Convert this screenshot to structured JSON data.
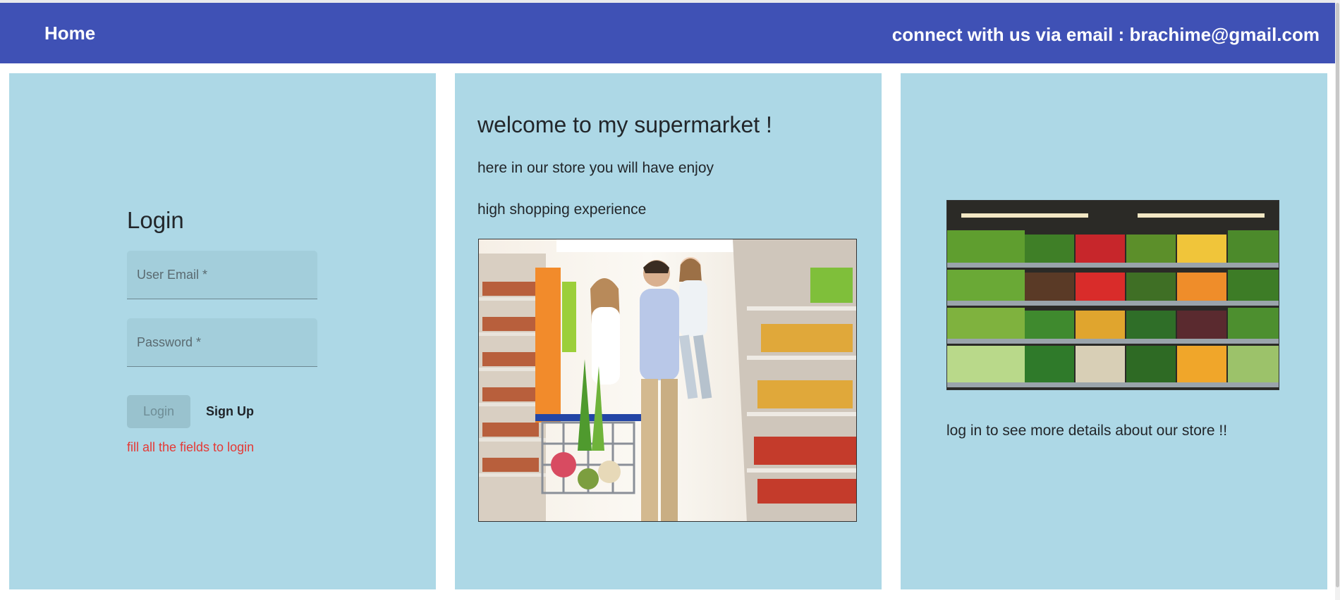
{
  "header": {
    "home_label": "Home",
    "contact_text": "connect with us via email :  brachime@gmail.com"
  },
  "login": {
    "title": "Login",
    "email_placeholder": "User Email *",
    "password_placeholder": "Password *",
    "login_button": "Login",
    "signup_button": "Sign Up",
    "error_message": "fill all the fields to login"
  },
  "welcome": {
    "title": "welcome to my supermarket !",
    "line1": "here in our store you will have enjoy",
    "line2": "high shopping experience"
  },
  "store": {
    "note": "log in to see more details about our store !!"
  },
  "colors": {
    "header_bg": "#3f51b5",
    "panel_bg": "#add8e6",
    "error": "#e53935"
  }
}
